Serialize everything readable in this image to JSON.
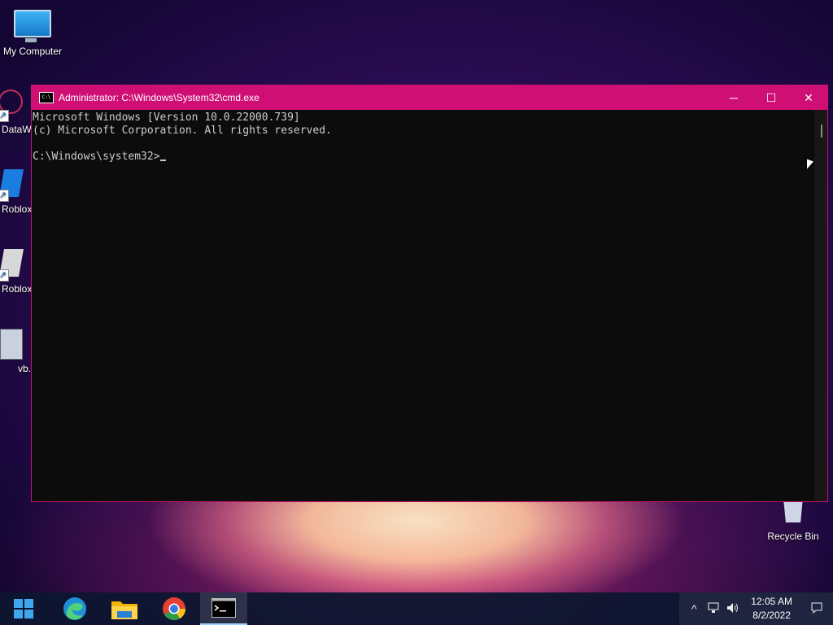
{
  "desktop": {
    "icons": [
      {
        "label": "My Computer"
      },
      {
        "label": "DataW"
      },
      {
        "label": "Roblox"
      },
      {
        "label": "Roblox"
      },
      {
        "label": "vb."
      },
      {
        "label": "Recycle Bin"
      }
    ]
  },
  "window": {
    "title": "Administrator: C:\\Windows\\System32\\cmd.exe",
    "minimize": "─",
    "maximize": "☐",
    "close": "✕",
    "console_lines": [
      "Microsoft Windows [Version 10.0.22000.739]",
      "(c) Microsoft Corporation. All rights reserved.",
      "",
      "C:\\Windows\\system32>"
    ]
  },
  "taskbar": {
    "apps": [
      {
        "name": "start-icon"
      },
      {
        "name": "edge-icon"
      },
      {
        "name": "file-explorer-icon"
      },
      {
        "name": "chrome-icon"
      },
      {
        "name": "cmd-icon"
      }
    ],
    "tray": {
      "chevron": "^",
      "time": "12:05 AM",
      "date": "8/2/2022"
    }
  },
  "colors": {
    "titlebar": "#cf0f74",
    "console_bg": "#0c0c0c",
    "console_text": "#cccccc"
  }
}
